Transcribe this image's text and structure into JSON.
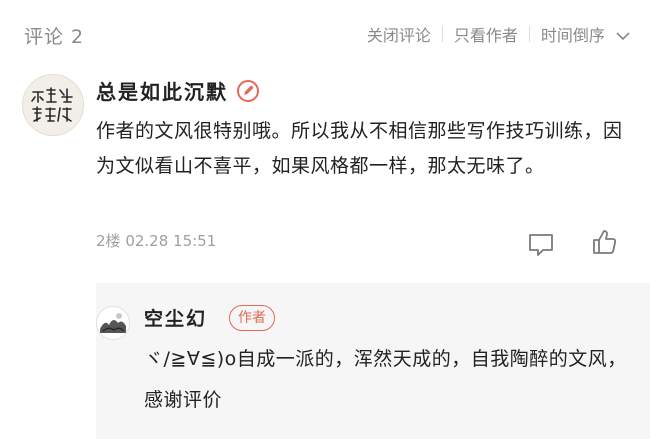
{
  "header": {
    "title": "评论 2",
    "close_comments": "关闭评论",
    "only_author": "只看作者",
    "sort_order": "时间倒序"
  },
  "comment": {
    "avatar_icon": "calligraphy-avatar",
    "avatar_text": "不想输就别做",
    "author": "总是如此沉默",
    "text": "作者的文风很特别哦。所以我从不相信那些写作技巧训练，因为文似看山不喜平，如果风格都一样，那太无味了。",
    "floor": "2楼",
    "timestamp": "02.28 15:51",
    "reply_icon": "comment-icon",
    "like_icon": "thumbs-up-icon"
  },
  "reply": {
    "avatar_icon": "ink-landscape-avatar",
    "author": "空尘幻",
    "badge": "作者",
    "text": "ヾ/≧∀≦)o自成一派的，浑然天成的，自我陶醉的文风，感谢评价"
  },
  "colors": {
    "accent": "#e26a5a",
    "muted": "#8a8a8a",
    "reply_bg": "#f6f6f6"
  }
}
